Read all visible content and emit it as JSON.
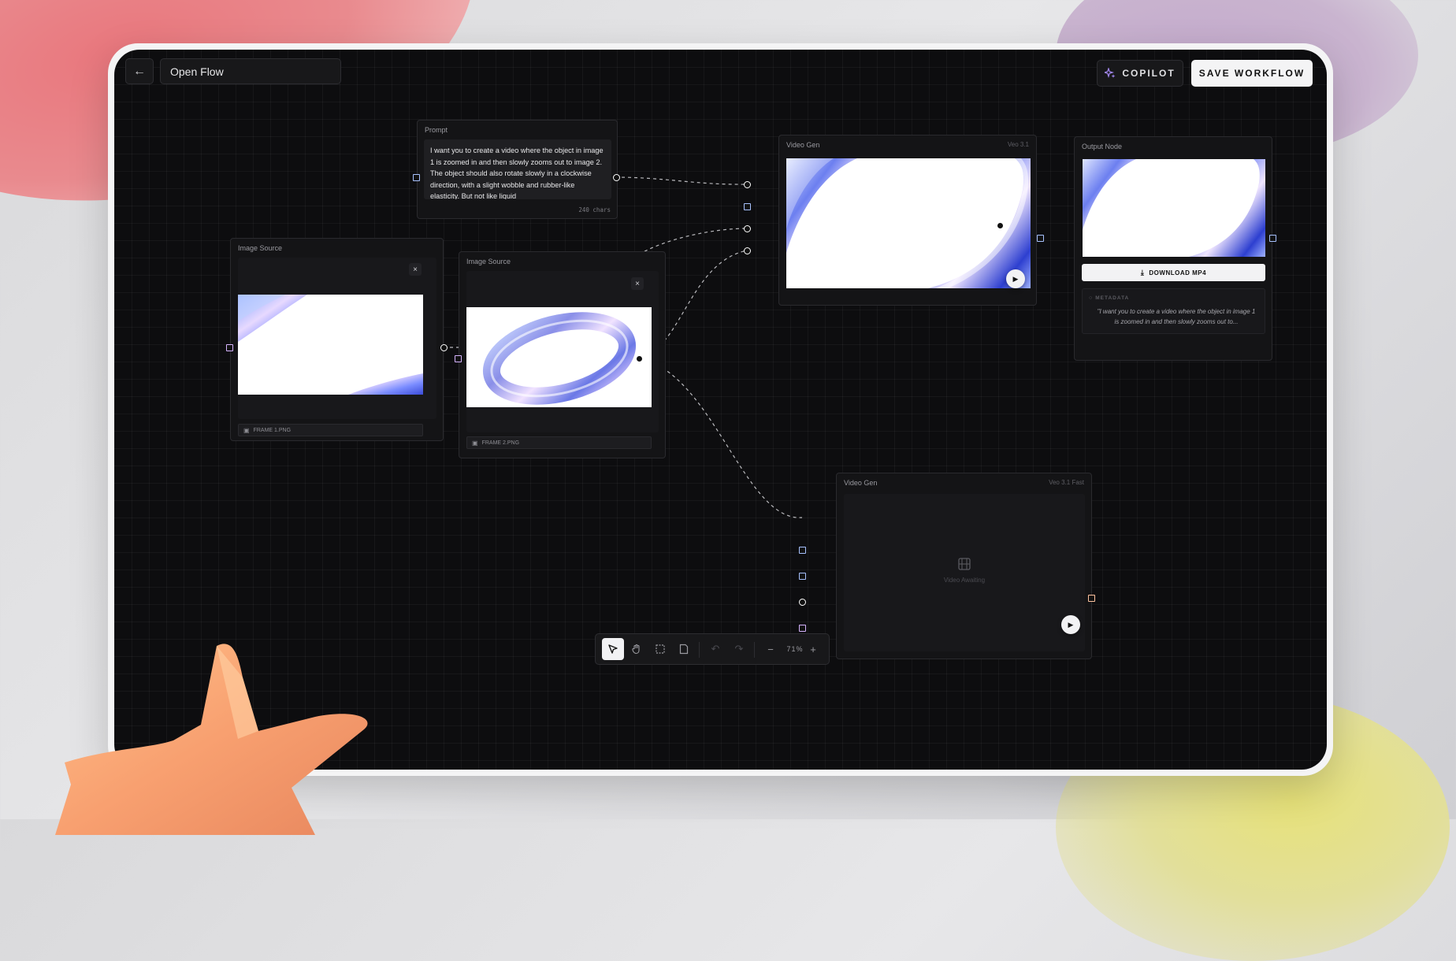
{
  "header": {
    "back_icon": "arrow-left-icon",
    "flow_name": "Open Flow",
    "copilot_label": "COPILOT",
    "copilot_icon": "sparkle-icon",
    "save_label": "SAVE WORKFLOW"
  },
  "prompt_node": {
    "title": "Prompt",
    "text": "I want you to create a video where the object in image 1 is zoomed in and then slowly zooms out to image 2. The object should also rotate slowly in a clockwise direction, with a slight wobble and rubber-like elasticity. But not like liquid",
    "char_count": "240 chars"
  },
  "image_source_1": {
    "title": "Image Source",
    "file": "FRAME 1.PNG",
    "close": "×"
  },
  "image_source_2": {
    "title": "Image Source",
    "file": "FRAME 2.PNG",
    "close": "×"
  },
  "video_gen_1": {
    "title": "Video Gen",
    "model": "Veo 3.1"
  },
  "output_node": {
    "title": "Output Node",
    "download_label": "DOWNLOAD MP4",
    "metadata_label": "METADATA",
    "metadata_text": "\"I want you to create a video where the object in image 1 is zoomed in and then slowly zooms out to..."
  },
  "video_gen_2": {
    "title": "Video Gen",
    "model": "Veo 3.1 Fast",
    "placeholder": "Video Awaiting"
  },
  "toolbar": {
    "tools": [
      "select-icon",
      "hand-icon",
      "marquee-icon",
      "note-icon",
      "undo-icon",
      "redo-icon",
      "zoom-out-icon",
      "zoom-in-icon"
    ],
    "zoom_level": "71%",
    "zoom_out": "−",
    "zoom_in": "+"
  },
  "colors": {
    "canvas": "#0d0d0f",
    "node": "#141416",
    "accent_blue": "#a8c2ff",
    "accent_purple": "#d6b4ff",
    "accent_orange": "#ffc3a0"
  }
}
